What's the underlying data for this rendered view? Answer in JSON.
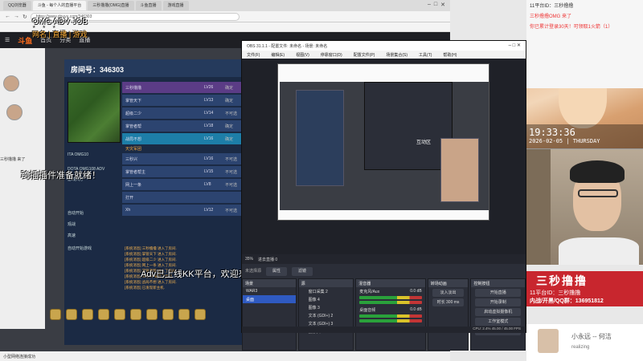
{
  "browser": {
    "tabs": [
      "QQ浏览器",
      "斗鱼 - 每个人的直播平台",
      "三秒撸撸(OMG)直播",
      "斗鱼直播",
      "游戏直播"
    ],
    "url": "https://www.douyu.com/346303",
    "window_title_obs": "OBS 31.1.1 - 配置文件: 未命名 - 场景: 未命名"
  },
  "site": {
    "logo": "斗鱼",
    "nav": [
      "首页",
      "分类",
      "直播"
    ],
    "status_left": "小型网络连接成功"
  },
  "lobby": {
    "room_label": "房间号：346303",
    "map_name": "ITA OMG10",
    "map_info": "DOTA OMG108 ADV",
    "options": [
      "游戏大厅",
      "自动开始",
      "观战",
      "高速",
      "自动开始游戏"
    ],
    "team_header": "天灾军团",
    "players": [
      {
        "name": "三秒撸撸",
        "lv": "LV26",
        "st": "确定"
      },
      {
        "name": "掌管天下",
        "lv": "LV13",
        "st": "确定"
      },
      {
        "name": "超级二少",
        "lv": "LV14",
        "st": "不可选"
      },
      {
        "name": "掌管者帮",
        "lv": "LV18",
        "st": "确定"
      },
      {
        "name": "战局不想",
        "lv": "LV16",
        "st": "确定"
      },
      {
        "name": "三秒兴",
        "lv": "LV16",
        "st": "不可选"
      },
      {
        "name": "掌管者帮主",
        "lv": "LV15",
        "st": "不可选"
      },
      {
        "name": "网上一条",
        "lv": "LV8",
        "st": "不可选"
      },
      {
        "name": "打开",
        "lv": "",
        "st": ""
      },
      {
        "name": "Xh",
        "lv": "LV12",
        "st": "不可选"
      }
    ],
    "chat": [
      "[系统消息] 三秒撸撸 进入了房间.",
      "[系统消息] 掌管天下 进入了房间.",
      "[系统消息] 超级二少 进入了房间.",
      "[系统消息] 网上一条 进入了房间.",
      "[系统消息] 掌管者帮 进入了房间.",
      "[系统消息] 三秒兴 离开了房间.",
      "[系统消息] 战局不想 进入了房间.",
      "[系统消息] 已发现新主机."
    ]
  },
  "overlays": {
    "plugin_ready": "跨插插件准备就绪！",
    "announce": "Adv已上线KK平台，欢迎来玩！QQ交流群：1028300994",
    "top_left_1": "OMG ADV JOB",
    "top_left_2": "网名 | 直播 | 游戏",
    "chat_join": "三秒撸撸 来了",
    "mini_label": "互动区"
  },
  "obs": {
    "menu": [
      "文件(F)",
      "编辑(E)",
      "视图(V)",
      "停靠窗口(D)",
      "配置文件(P)",
      "场景集合(S)",
      "工具(T)",
      "帮助(H)"
    ],
    "scene_row": [
      "35%",
      "进去直播 0"
    ],
    "dock_buttons": [
      "未选择源",
      "属性",
      "滤镜"
    ],
    "scenes_title": "场景",
    "scenes": [
      "WAR3",
      "桌面"
    ],
    "sources_title": "源",
    "sources": [
      "窗口采集 2",
      "图像 4",
      "图像 3",
      "文本 (GDI+) 2",
      "文本 (GDI+) 3",
      "摄像头"
    ],
    "mixer_title": "混音器",
    "mixer": [
      {
        "name": "麦克风/Aux",
        "db": "0.0 dB"
      },
      {
        "name": "桌面音频",
        "db": "0.0 dB"
      }
    ],
    "transitions_title": "转场动画",
    "transitions": [
      "淡入淡出",
      "时长 300 ms"
    ],
    "controls_title": "控制按钮",
    "controls": [
      "开始直播",
      "开始录制",
      "启动虚拟摄像机",
      "工作室模式",
      "设置"
    ],
    "status": "CPU: 2.4%   45.00 / 45.00 FPS"
  },
  "right": {
    "chat": [
      {
        "text": "11平台ID：三秒撸撸",
        "red": false
      },
      {
        "text": "三秒撸撸OMG 来了",
        "red": true
      },
      {
        "text": "你已累计登录30天！可领取1火箭（1）",
        "red": true
      }
    ],
    "time": "19:33:36",
    "date": "2026-02-05 | THURSDAY",
    "name_big": "三秒撸撸",
    "platform": "11平台ID：三秒撸撸",
    "qq": "内战/开黑/QQ群：136951812",
    "sub_name": "小永远 -- 何洁",
    "sub_id": "realizing"
  }
}
